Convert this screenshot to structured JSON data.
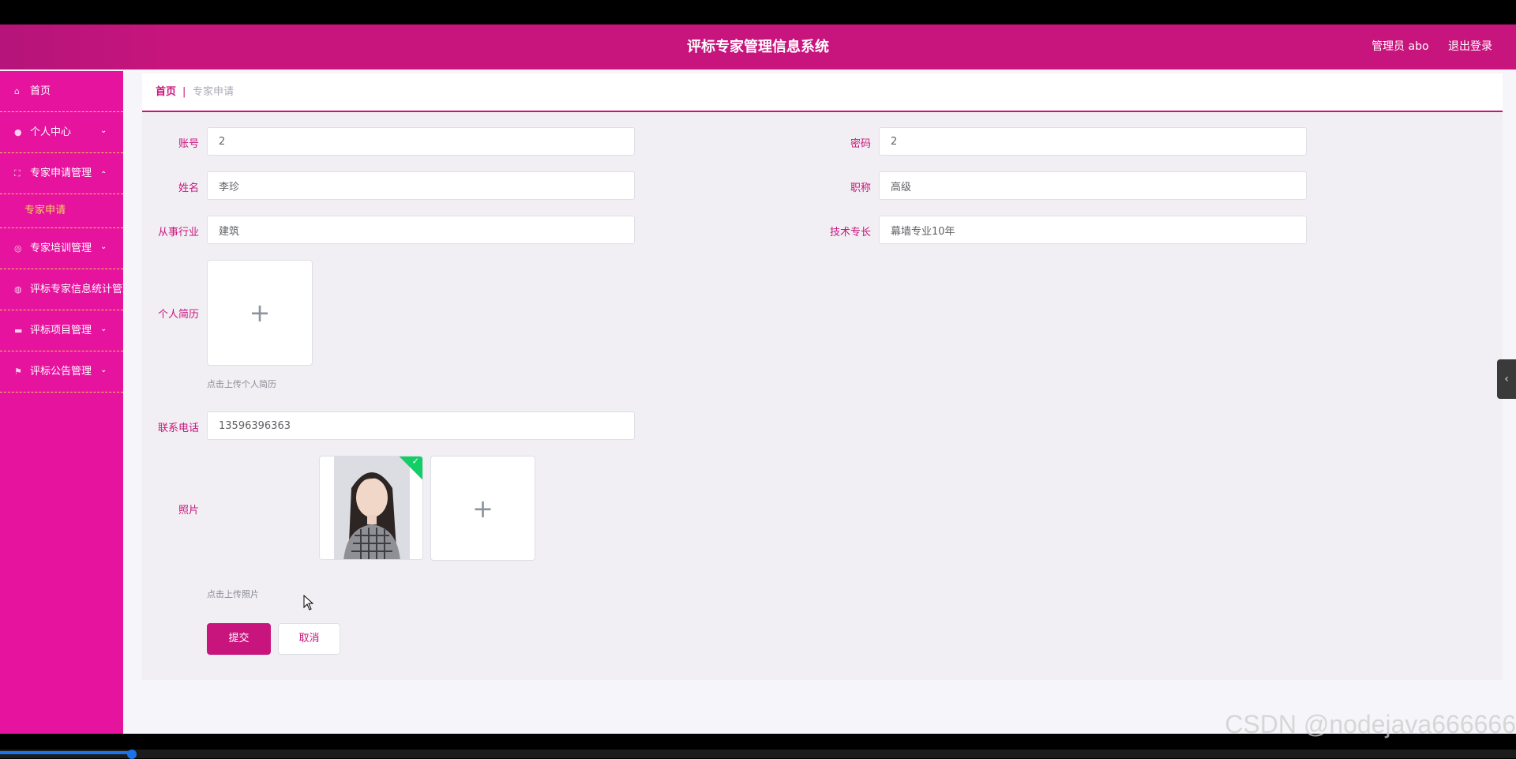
{
  "header": {
    "title": "评标专家管理信息系统",
    "user": "管理员 abo",
    "logout": "退出登录"
  },
  "sidebar": {
    "items": [
      {
        "label": "首页",
        "icon": "home-icon"
      },
      {
        "label": "个人中心",
        "icon": "user-icon",
        "arrow": "chevron-down"
      },
      {
        "label": "专家申请管理",
        "icon": "expand-icon",
        "arrow": "chevron-up",
        "expanded": true
      },
      {
        "label": "专家培训管理",
        "icon": "compass-icon",
        "arrow": "chevron-down"
      },
      {
        "label": "评标专家信息统计管理",
        "icon": "globe-icon",
        "arrow": "chevron-down"
      },
      {
        "label": "评标项目管理",
        "icon": "ticket-icon",
        "arrow": "chevron-down"
      },
      {
        "label": "评标公告管理",
        "icon": "flag-icon",
        "arrow": "chevron-down"
      }
    ],
    "submenu": {
      "label": "专家申请"
    }
  },
  "breadcrumb": {
    "home": "首页",
    "separator": "|",
    "current": "专家申请"
  },
  "form": {
    "account": {
      "label": "账号",
      "value": "2"
    },
    "password": {
      "label": "密码",
      "value": "2"
    },
    "name": {
      "label": "姓名",
      "value": "李珍"
    },
    "title": {
      "label": "职称",
      "value": "高级"
    },
    "industry": {
      "label": "从事行业",
      "value": "建筑"
    },
    "specialty": {
      "label": "技术专长",
      "value": "幕墙专业10年"
    },
    "resume": {
      "label": "个人简历",
      "hint": "点击上传个人简历"
    },
    "phone": {
      "label": "联系电话",
      "value": "13596396363"
    },
    "photo": {
      "label": "照片",
      "hint": "点击上传照片",
      "uploaded_count": 1
    },
    "submit": "提交",
    "cancel": "取消"
  },
  "watermark": "CSDN @nodejava666666",
  "colors": {
    "brand": "#c8157d",
    "sidebar": "#e5139d",
    "submenu_text": "#f6d65b",
    "success": "#13ce66"
  }
}
